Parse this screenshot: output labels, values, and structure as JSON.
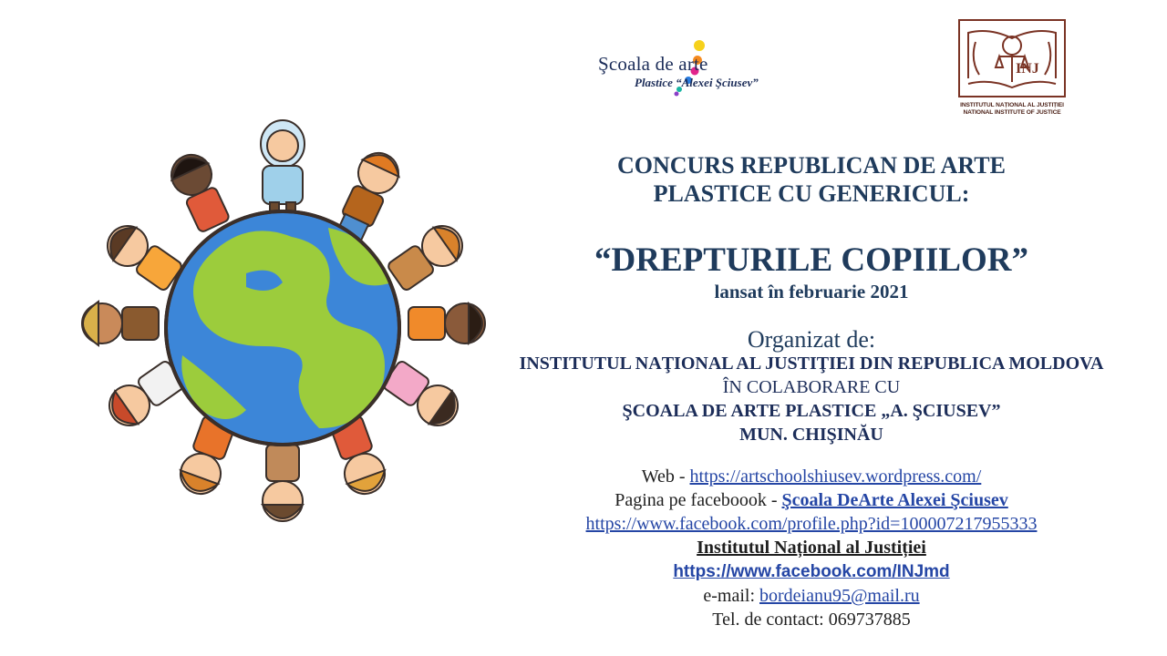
{
  "logos": {
    "school": {
      "name": "Şcoala de arte",
      "subtitle": "Plastice “Alexei Şciusev”",
      "dot_colors": [
        "#f6d11c",
        "#f58a1f",
        "#e2258c",
        "#2a7de1",
        "#18b5a3",
        "#8b3fc7"
      ]
    },
    "inj": {
      "emblem": "INJ",
      "caption_ro": "INSTITUTUL NAȚIONAL AL JUSTIȚIEI",
      "caption_en": "NATIONAL INSTITUTE OF JUSTICE",
      "color": "#7a3324"
    }
  },
  "illustration": {
    "subject": "children-around-globe",
    "colors": {
      "water": "#3c86d8",
      "land": "#9ccc3c",
      "outline": "#3a2f2a"
    }
  },
  "contest": {
    "heading": "CONCURS REPUBLICAN DE ARTE PLASTICE CU GENERICUL:",
    "title": "“DREPTURILE COPIILOR”",
    "launched": "lansat în februarie 2021"
  },
  "organizer": {
    "label": "Organizat de:",
    "institute": "INSTITUTUL NAŢIONAL AL JUSTIŢIEI DIN REPUBLICA MOLDOVA",
    "collab": "ÎN COLABORARE CU",
    "school": "ŞCOALA DE ARTE PLASTICE „A. ŞCIUSEV”",
    "city": "MUN. CHIŞINĂU"
  },
  "contacts": {
    "web_label": "Web - ",
    "web_url": "https://artschoolshiusev.wordpress.com/",
    "fb_label": "Pagina pe faceboook - ",
    "fb_page": "Şcoala DeArte Alexei Şciusev",
    "fb_profile_url": "https://www.facebook.com/profile.php?id=100007217955333",
    "inj_name": "Institutul Național al Justiției",
    "inj_fb_url": "https://www.facebook.com/INJmd",
    "email_label": "e-mail: ",
    "email": "bordeianu95@mail.ru",
    "phone_label": "Tel. de contact: ",
    "phone": "069737885"
  }
}
